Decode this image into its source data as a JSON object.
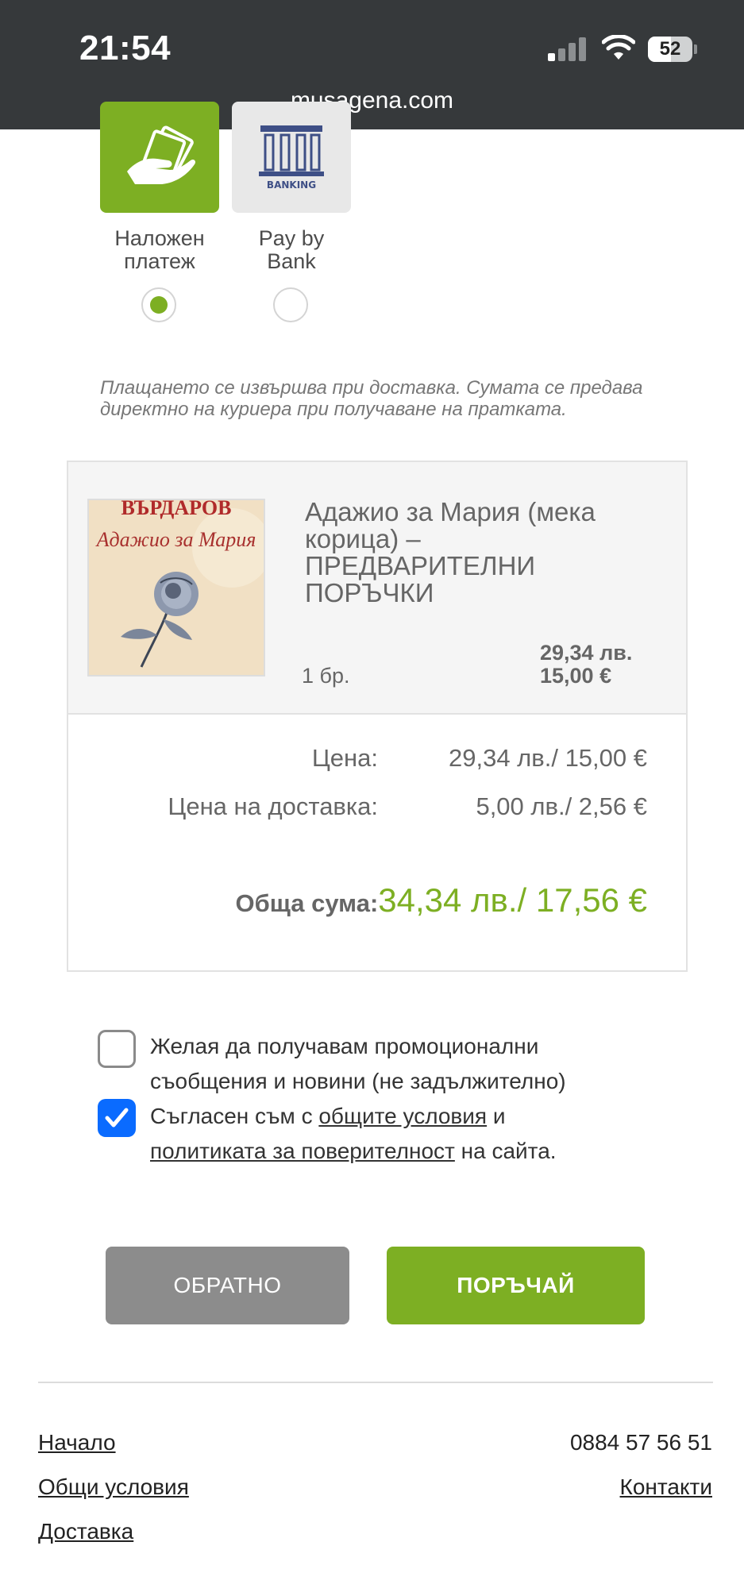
{
  "status_bar": {
    "time": "21:54",
    "battery": "52",
    "battery_level": 0.52
  },
  "browser": {
    "url": "musagena.com"
  },
  "payment": {
    "options": [
      {
        "label_line1": "Наложен",
        "label_line2": "платеж",
        "selected": true
      },
      {
        "label_line1": "Pay by",
        "label_line2": "Bank",
        "selected": false,
        "card_text": "BANKING"
      }
    ],
    "note": "Плащането се извършва при доставка. Сумата се предава директно на куриера при получаване на пратката."
  },
  "order": {
    "item": {
      "cover_author": "ВЪРДАРОВ",
      "cover_title": "Адажио за Мария",
      "name": "Адажио за Мария (мека корица) – ПРЕДВАРИТЕЛНИ ПОРЪЧКИ",
      "qty": "1 бр.",
      "price_bgn": "29,34 лв.",
      "price_eur": "15,00 €"
    },
    "price_label": "Цена:",
    "price_value": "29,34 лв./ 15,00 €",
    "shipping_label": "Цена на доставка:",
    "shipping_value": "5,00 лв./ 2,56 €",
    "total_label": "Обща сума:",
    "total_value": "34,34 лв./ 17,56 €"
  },
  "consents": {
    "newsletter": {
      "checked": false,
      "line1": "Желая да получавам промоционални",
      "line2": "съобщения и новини (не задължително)"
    },
    "terms": {
      "checked": true,
      "prefix": "Съгласен съм с ",
      "terms_link": "общите условия",
      "and": " и",
      "privacy_link": "политиката за поверителност",
      "suffix": " на сайта."
    }
  },
  "buttons": {
    "back": "ОБРАТНО",
    "order": "ПОРЪЧАЙ"
  },
  "footer": {
    "home": "Начало",
    "terms": "Общи условия",
    "delivery": "Доставка",
    "phone": "0884 57 56 51",
    "contacts": "Контакти"
  },
  "colors": {
    "accent": "#7daf23",
    "topbar": "#36393b",
    "checkbox_checked": "#0a6bff",
    "back_button": "#8c8c8c"
  }
}
